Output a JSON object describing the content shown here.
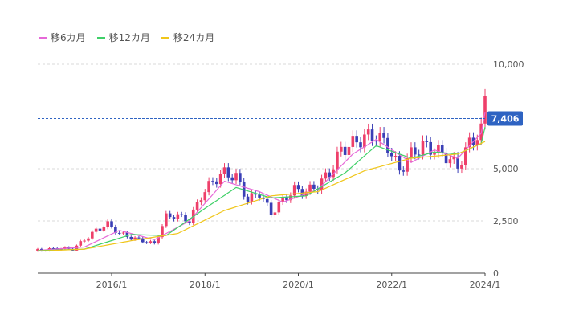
{
  "legend": [
    {
      "label": "移6カ月",
      "color": "#e668d8"
    },
    {
      "label": "移12カ月",
      "color": "#3fd068"
    },
    {
      "label": "移24カ月",
      "color": "#f0c61b"
    }
  ],
  "chart_data": {
    "type": "candlestick",
    "y_ticks": [
      {
        "value": 0,
        "label": "0"
      },
      {
        "value": 2500,
        "label": "2,500"
      },
      {
        "value": 5000,
        "label": "5,000"
      },
      {
        "value": 10000,
        "label": "10,000"
      }
    ],
    "x_ticks": [
      {
        "date": "2016-01",
        "label": "2016/1"
      },
      {
        "date": "2018-01",
        "label": "2018/1"
      },
      {
        "date": "2020-01",
        "label": "2020/1"
      },
      {
        "date": "2022-01",
        "label": "2022/1"
      },
      {
        "date": "2024-01",
        "label": "2024/1"
      }
    ],
    "x_range": [
      "2014-06",
      "2024-01"
    ],
    "ylim": [
      0,
      10000
    ],
    "grid": "horizontal-dashed",
    "current_price": {
      "value": 7406,
      "label": "7,406",
      "color": "#2e63c2"
    },
    "up_color": "#ee3f6a",
    "down_color": "#3a3fb6",
    "close_points": [
      [
        "2014-06",
        1100
      ],
      [
        "2014-09",
        1140
      ],
      [
        "2014-12",
        1180
      ],
      [
        "2015-03",
        1150
      ],
      [
        "2015-06",
        1600
      ],
      [
        "2015-09",
        2050
      ],
      [
        "2015-12",
        2350
      ],
      [
        "2016-03",
        1900
      ],
      [
        "2016-06",
        1700
      ],
      [
        "2016-09",
        1550
      ],
      [
        "2016-12",
        1400
      ],
      [
        "2017-03",
        2700
      ],
      [
        "2017-06",
        2750
      ],
      [
        "2017-09",
        2500
      ],
      [
        "2017-12",
        3700
      ],
      [
        "2018-03",
        4400
      ],
      [
        "2018-06",
        4800
      ],
      [
        "2018-09",
        4600
      ],
      [
        "2018-12",
        3500
      ],
      [
        "2019-03",
        3850
      ],
      [
        "2019-06",
        2850
      ],
      [
        "2019-09",
        3500
      ],
      [
        "2019-12",
        4000
      ],
      [
        "2020-03",
        3900
      ],
      [
        "2020-06",
        4200
      ],
      [
        "2020-09",
        4800
      ],
      [
        "2020-12",
        5900
      ],
      [
        "2021-03",
        6200
      ],
      [
        "2021-06",
        6500
      ],
      [
        "2021-09",
        6600
      ],
      [
        "2021-12",
        6100
      ],
      [
        "2022-03",
        4900
      ],
      [
        "2022-06",
        5700
      ],
      [
        "2022-09",
        6100
      ],
      [
        "2022-12",
        5900
      ],
      [
        "2023-03",
        5600
      ],
      [
        "2023-06",
        5100
      ],
      [
        "2023-09",
        6200
      ],
      [
        "2023-12",
        6800
      ],
      [
        "2024-01",
        8300
      ]
    ],
    "series": [
      {
        "name": "移6カ月",
        "values": [
          [
            "2014-06",
            1090
          ],
          [
            "2015-06",
            1250
          ],
          [
            "2016-03",
            2050
          ],
          [
            "2016-12",
            1600
          ],
          [
            "2017-09",
            2500
          ],
          [
            "2018-06",
            4400
          ],
          [
            "2019-03",
            3900
          ],
          [
            "2019-09",
            3400
          ],
          [
            "2020-06",
            4000
          ],
          [
            "2021-03",
            5700
          ],
          [
            "2021-09",
            6400
          ],
          [
            "2022-06",
            5300
          ],
          [
            "2022-12",
            5900
          ],
          [
            "2023-06",
            5500
          ],
          [
            "2023-12",
            6700
          ],
          [
            "2024-01",
            7700
          ]
        ]
      },
      {
        "name": "移12カ月",
        "values": [
          [
            "2014-06",
            1080
          ],
          [
            "2015-06",
            1150
          ],
          [
            "2016-06",
            1850
          ],
          [
            "2017-03",
            1800
          ],
          [
            "2018-01",
            3100
          ],
          [
            "2018-09",
            4100
          ],
          [
            "2019-06",
            3600
          ],
          [
            "2020-03",
            3700
          ],
          [
            "2021-01",
            4800
          ],
          [
            "2021-09",
            6100
          ],
          [
            "2022-06",
            5500
          ],
          [
            "2022-12",
            5800
          ],
          [
            "2023-06",
            5700
          ],
          [
            "2023-12",
            6200
          ],
          [
            "2024-01",
            7000
          ]
        ]
      },
      {
        "name": "移24カ月",
        "values": [
          [
            "2014-06",
            1060
          ],
          [
            "2015-06",
            1150
          ],
          [
            "2016-06",
            1550
          ],
          [
            "2017-06",
            1900
          ],
          [
            "2018-06",
            3000
          ],
          [
            "2019-06",
            3700
          ],
          [
            "2020-06",
            3900
          ],
          [
            "2021-06",
            4900
          ],
          [
            "2022-06",
            5500
          ],
          [
            "2023-06",
            5700
          ],
          [
            "2024-01",
            6300
          ]
        ]
      }
    ]
  }
}
